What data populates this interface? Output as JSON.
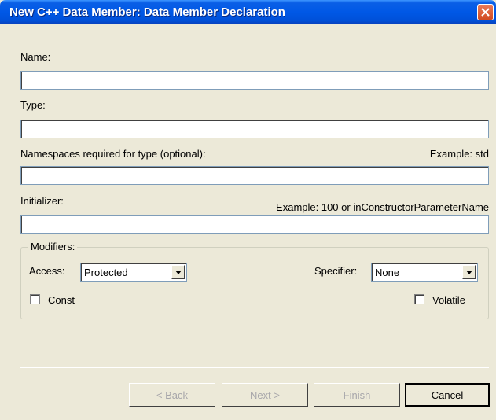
{
  "window": {
    "title": "New C++ Data Member: Data Member Declaration"
  },
  "fields": {
    "name": {
      "label": "Name:",
      "value": ""
    },
    "type": {
      "label": "Type:",
      "value": ""
    },
    "namespaces": {
      "label": "Namespaces required for type (optional):",
      "example": "Example: std",
      "value": ""
    },
    "initializer": {
      "label": "Initializer:",
      "example": "Example: 100 or inConstructorParameterName",
      "value": ""
    }
  },
  "modifiers": {
    "legend": "Modifiers:",
    "access": {
      "label": "Access:",
      "selected": "Protected"
    },
    "specifier": {
      "label": "Specifier:",
      "selected": "None"
    },
    "const": {
      "label": "Const",
      "checked": false
    },
    "volatile": {
      "label": "Volatile",
      "checked": false
    }
  },
  "buttons": {
    "back": "< Back",
    "next": "Next >",
    "finish": "Finish",
    "cancel": "Cancel"
  }
}
